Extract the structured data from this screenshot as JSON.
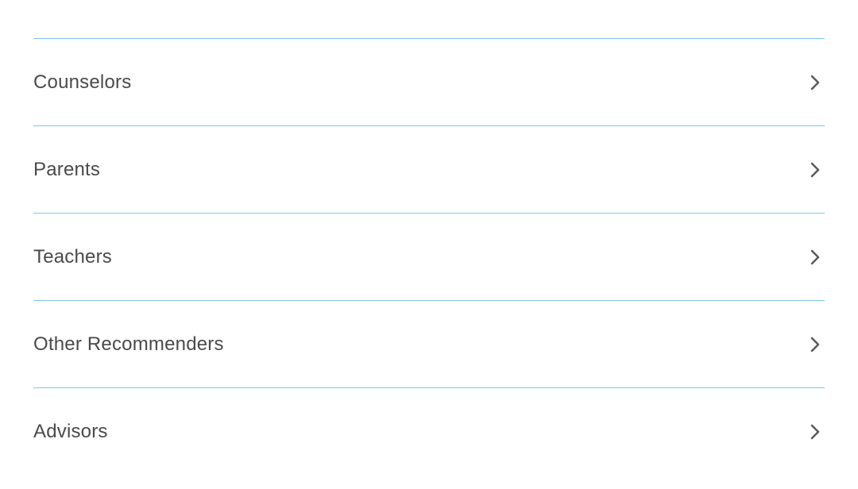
{
  "list": {
    "items": [
      {
        "label": "Counselors"
      },
      {
        "label": "Parents"
      },
      {
        "label": "Teachers"
      },
      {
        "label": "Other Recommenders"
      },
      {
        "label": "Advisors"
      }
    ]
  },
  "colors": {
    "divider": "#7fc9e6",
    "text": "#4a4a4a",
    "chevron": "#5a5a5a"
  }
}
